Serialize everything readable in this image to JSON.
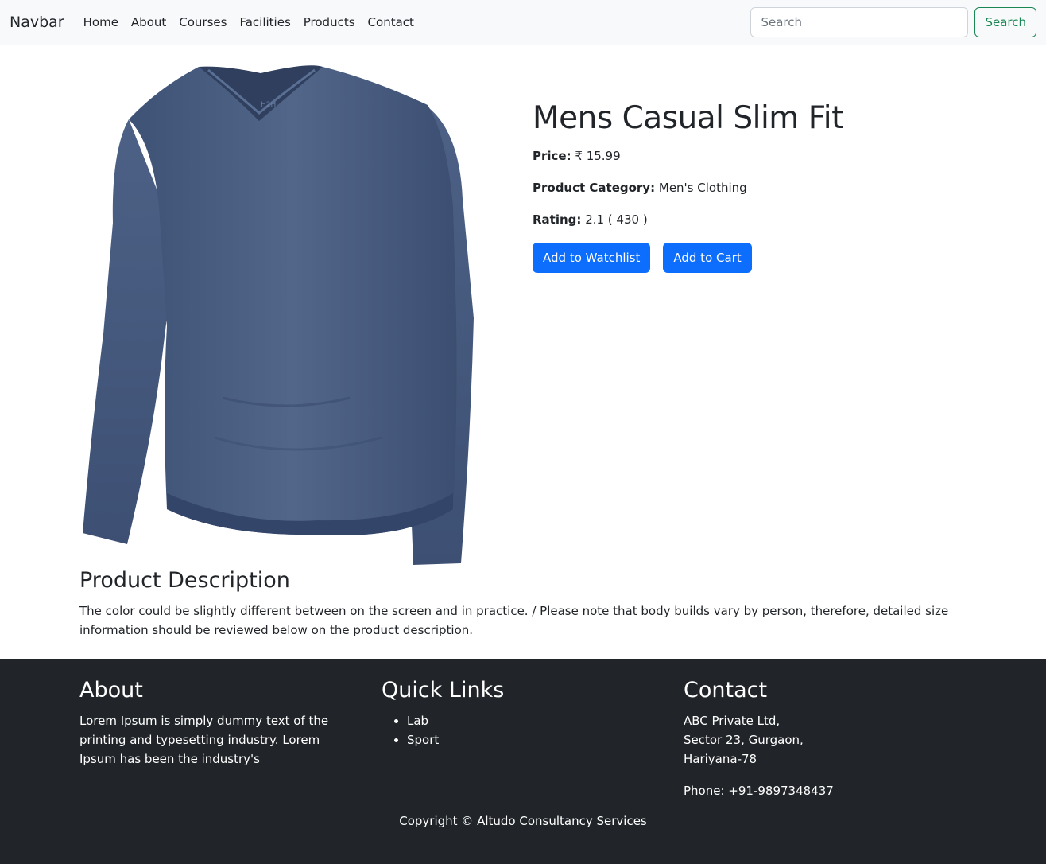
{
  "navbar": {
    "brand": "Navbar",
    "links": [
      "Home",
      "About",
      "Courses",
      "Facilities",
      "Products",
      "Contact"
    ],
    "search_placeholder": "Search",
    "search_button": "Search"
  },
  "product": {
    "title": "Mens Casual Slim Fit",
    "price_label": "Price:",
    "price_value": "₹ 15.99",
    "category_label": "Product Category:",
    "category_value": "Men's Clothing",
    "rating_label": "Rating:",
    "rating_value": "2.1 ( 430 )",
    "watchlist_button": "Add to Watchlist",
    "cart_button": "Add to Cart",
    "image_brand_mark": "H2H"
  },
  "description": {
    "title": "Product Description",
    "text": "The color could be slightly different between on the screen and in practice. / Please note that body builds vary by person, therefore, detailed size information should be reviewed below on the product description."
  },
  "footer": {
    "about_title": "About",
    "about_text": "Lorem Ipsum is simply dummy text of the printing and typesetting industry. Lorem Ipsum has been the industry's",
    "links_title": "Quick Links",
    "links": [
      "Lab",
      "Sport"
    ],
    "contact_title": "Contact",
    "address_line1": "ABC Private Ltd,",
    "address_line2": "Sector 23, Gurgaon,",
    "address_line3": "Hariyana-78",
    "phone": "Phone: +91-9897348437",
    "copyright": "Copyright © Altudo Consultancy Services"
  },
  "colors": {
    "navbar_bg": "#f8f9fa",
    "primary": "#0d6efd",
    "success": "#198754",
    "footer_bg": "#212529",
    "shirt": "#4a5f82"
  }
}
